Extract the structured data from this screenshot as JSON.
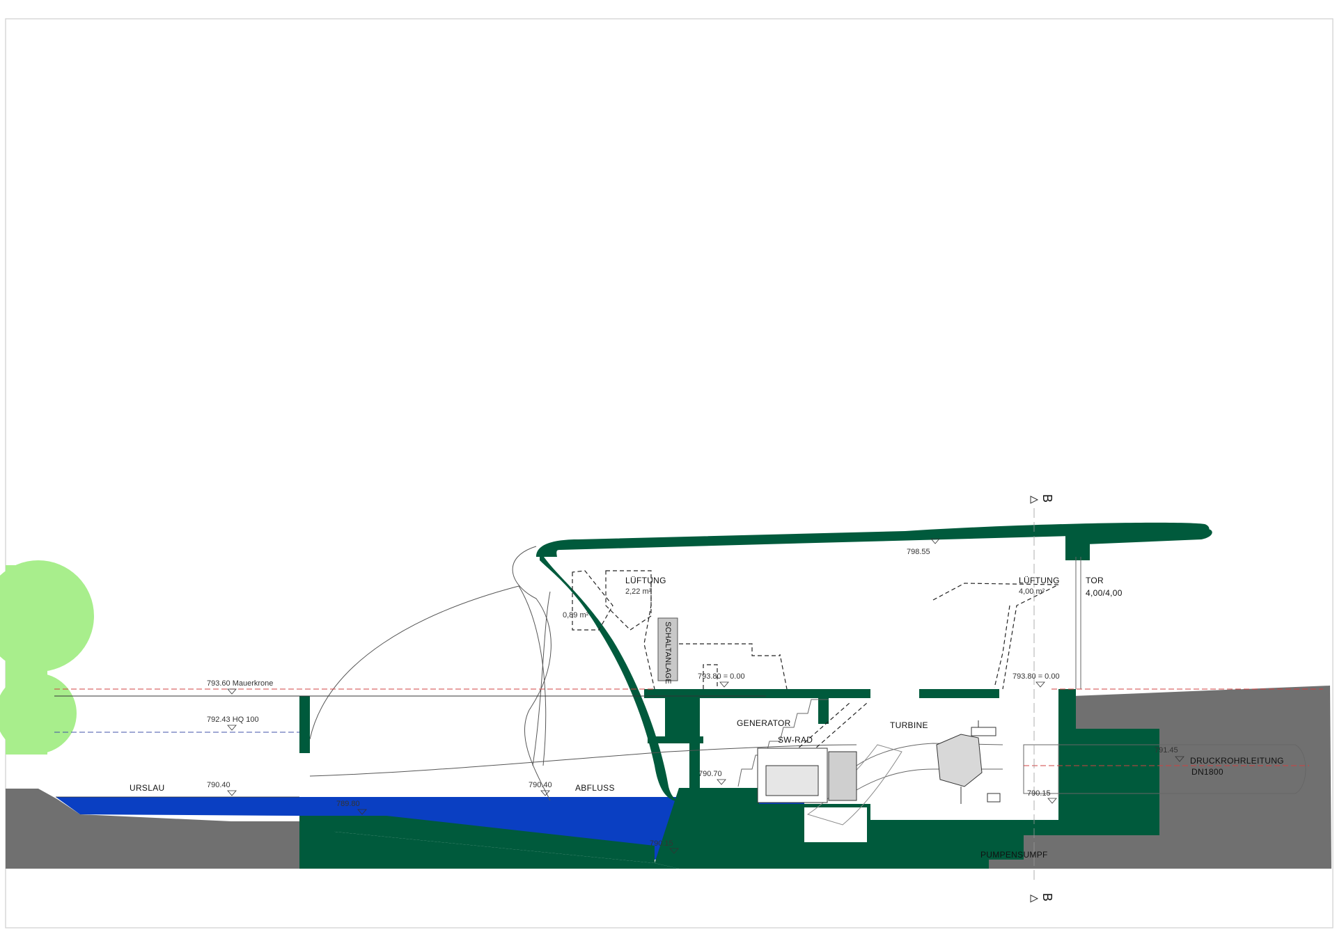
{
  "drawing": {
    "colors": {
      "concrete": "#005a3c",
      "ground": "#707070",
      "water": "#0a3fc2",
      "tree": "#a8ee8c",
      "ref_red": "#d04040",
      "ref_blue": "#4050a8"
    },
    "section_marker": "B",
    "labels": {
      "urslau": "URSLAU",
      "abfluss": "ABFLUSS",
      "generator": "GENERATOR",
      "sw_rad": "SW-RAD",
      "turbine": "TURBINE",
      "druckrohr_1": "DRUCKROHRLEITUNG",
      "druckrohr_2": "DN1800",
      "pumpensumpf": "PUMPENSUMPF",
      "schaltanlage": "SCHALTANLAGE",
      "tor_1": "TOR",
      "tor_2": "4,00/4,00",
      "lueftung_left": "LÜFTUNG",
      "lueftung_left_area": "2,22 m²",
      "lueftung_right": "LÜFTUNG",
      "lueftung_right_area": "4,00 m²",
      "area_small": "0,89 m²"
    },
    "levels": {
      "mauerkrone": "793.60 Mauerkrone",
      "hq100": "792.43 HQ 100",
      "urslau_wl": "790.40",
      "abfluss_wl": "790.40",
      "channel_a": "789.80",
      "channel_b": "790.15",
      "roof": "798.55",
      "floor_left": "793.80 = 0.00",
      "floor_right": "793.80 = 0.00",
      "gen_floor": "790.70",
      "turb_floor": "790.15",
      "pipe": "791.45"
    }
  }
}
